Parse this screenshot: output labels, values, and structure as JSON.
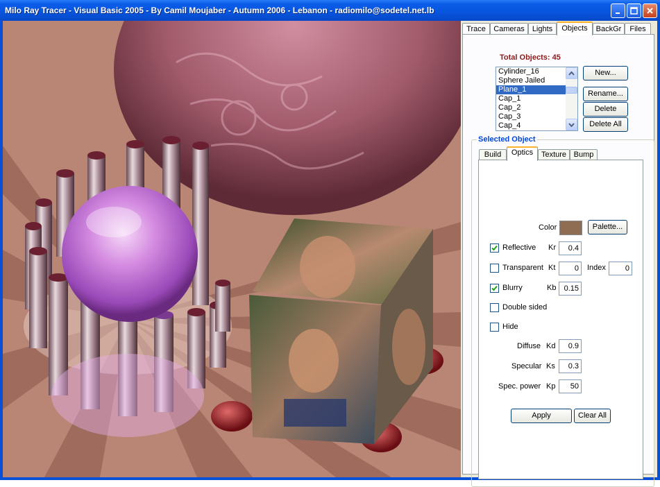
{
  "window": {
    "title": "Milo Ray Tracer - Visual Basic 2005 - By Camil Moujaber - Autumn 2006 - Lebanon - radiomilo@sodetel.net.lb"
  },
  "tabs": [
    {
      "label": "Trace"
    },
    {
      "label": "Cameras"
    },
    {
      "label": "Lights"
    },
    {
      "label": "Objects",
      "active": true
    },
    {
      "label": "BackGr"
    },
    {
      "label": "Files"
    }
  ],
  "objects": {
    "total_label": "Total Objects:",
    "total_count": "45",
    "list": [
      {
        "label": "Cylinder_16"
      },
      {
        "label": "Sphere Jailed"
      },
      {
        "label": "Plane_1",
        "selected": true
      },
      {
        "label": "Cap_1"
      },
      {
        "label": "Cap_2"
      },
      {
        "label": "Cap_3"
      },
      {
        "label": "Cap_4"
      }
    ],
    "buttons": {
      "new": "New...",
      "rename": "Rename...",
      "delete": "Delete",
      "delete_all": "Delete All"
    }
  },
  "selected_object": {
    "group_label": "Selected Object",
    "tabs": [
      {
        "label": "Build"
      },
      {
        "label": "Optics",
        "active": true
      },
      {
        "label": "Texture"
      },
      {
        "label": "Bump"
      }
    ],
    "optics": {
      "color_label": "Color",
      "color": "#8e6d52",
      "palette_button": "Palette...",
      "reflective": {
        "label": "Reflective",
        "checked": true,
        "coef_label": "Kr",
        "value": "0.4"
      },
      "transparent": {
        "label": "Transparent",
        "checked": false,
        "coef_label": "Kt",
        "value": "0",
        "index_label": "Index",
        "index_value": "0"
      },
      "blurry": {
        "label": "Blurry",
        "checked": true,
        "coef_label": "Kb",
        "value": "0.15"
      },
      "double_sided": {
        "label": "Double sided",
        "checked": false
      },
      "hide": {
        "label": "Hide",
        "checked": false
      },
      "diffuse": {
        "label": "Diffuse",
        "coef_label": "Kd",
        "value": "0.9"
      },
      "specular": {
        "label": "Specular",
        "coef_label": "Ks",
        "value": "0.3"
      },
      "spec_power": {
        "label": "Spec. power",
        "coef_label": "Kp",
        "value": "50"
      },
      "apply_button": "Apply",
      "clear_all_button": "Clear All"
    }
  },
  "colors": {
    "title_bar": "#0a5ce8",
    "selection": "#316ac5",
    "total_label": "#8b1a1a",
    "group_label": "#0046d5"
  }
}
